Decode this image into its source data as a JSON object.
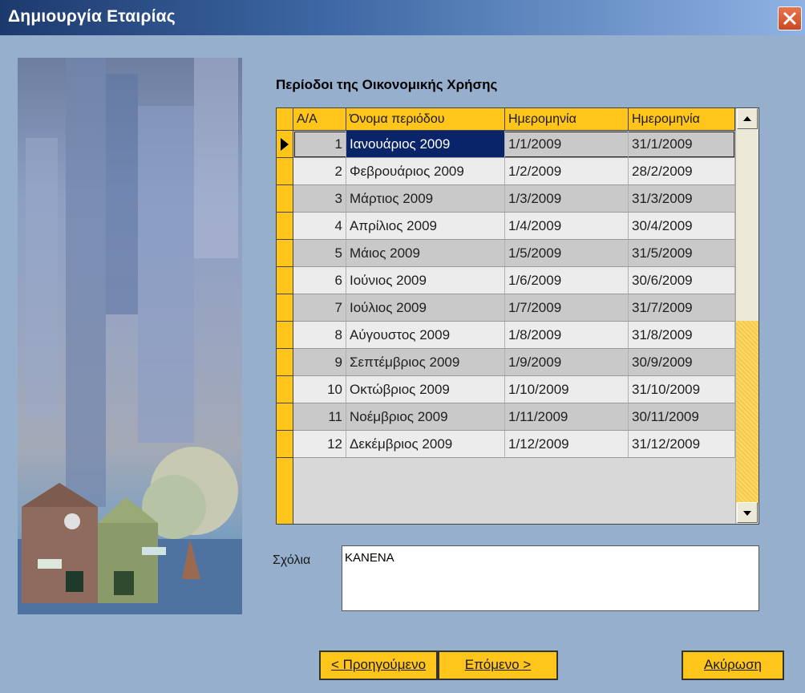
{
  "window": {
    "title": "Δημιουργία Εταιρίας"
  },
  "section": {
    "title": "Περίοδοι της Οικονομικής Χρήσης"
  },
  "grid": {
    "headers": [
      "Α/Α",
      "Όνομα περιόδου",
      "Ημερομηνία",
      "Ημερομηνία"
    ],
    "rows": [
      {
        "n": "1",
        "name": "Ιανουάριος 2009",
        "start": "1/1/2009",
        "end": "31/1/2009"
      },
      {
        "n": "2",
        "name": "Φεβρουάριος 2009",
        "start": "1/2/2009",
        "end": "28/2/2009"
      },
      {
        "n": "3",
        "name": "Μάρτιος 2009",
        "start": "1/3/2009",
        "end": "31/3/2009"
      },
      {
        "n": "4",
        "name": "Απρίλιος 2009",
        "start": "1/4/2009",
        "end": "30/4/2009"
      },
      {
        "n": "5",
        "name": "Μάιος 2009",
        "start": "1/5/2009",
        "end": "31/5/2009"
      },
      {
        "n": "6",
        "name": "Ιούνιος 2009",
        "start": "1/6/2009",
        "end": "30/6/2009"
      },
      {
        "n": "7",
        "name": "Ιούλιος 2009",
        "start": "1/7/2009",
        "end": "31/7/2009"
      },
      {
        "n": "8",
        "name": "Αύγουστος 2009",
        "start": "1/8/2009",
        "end": "31/8/2009"
      },
      {
        "n": "9",
        "name": "Σεπτέμβριος 2009",
        "start": "1/9/2009",
        "end": "30/9/2009"
      },
      {
        "n": "10",
        "name": "Οκτώβριος 2009",
        "start": "1/10/2009",
        "end": "31/10/2009"
      },
      {
        "n": "11",
        "name": "Νοέμβριος 2009",
        "start": "1/11/2009",
        "end": "30/11/2009"
      },
      {
        "n": "12",
        "name": "Δεκέμβριος 2009",
        "start": "1/12/2009",
        "end": "31/12/2009"
      }
    ]
  },
  "comments": {
    "label": "Σχόλια",
    "value": "ΚΑΝΕΝΑ"
  },
  "buttons": {
    "prev": "< Προηγούμενο",
    "next": "Επόμενο >",
    "cancel": "Ακύρωση"
  },
  "icons": {
    "close": "close-icon",
    "row_indicator": "triangle-right-icon",
    "scroll_up": "arrow-up-icon",
    "scroll_down": "arrow-down-icon"
  },
  "colors": {
    "accent": "#ffc51a",
    "selection": "#0a246a",
    "titlebar": "#2c4f8a"
  }
}
